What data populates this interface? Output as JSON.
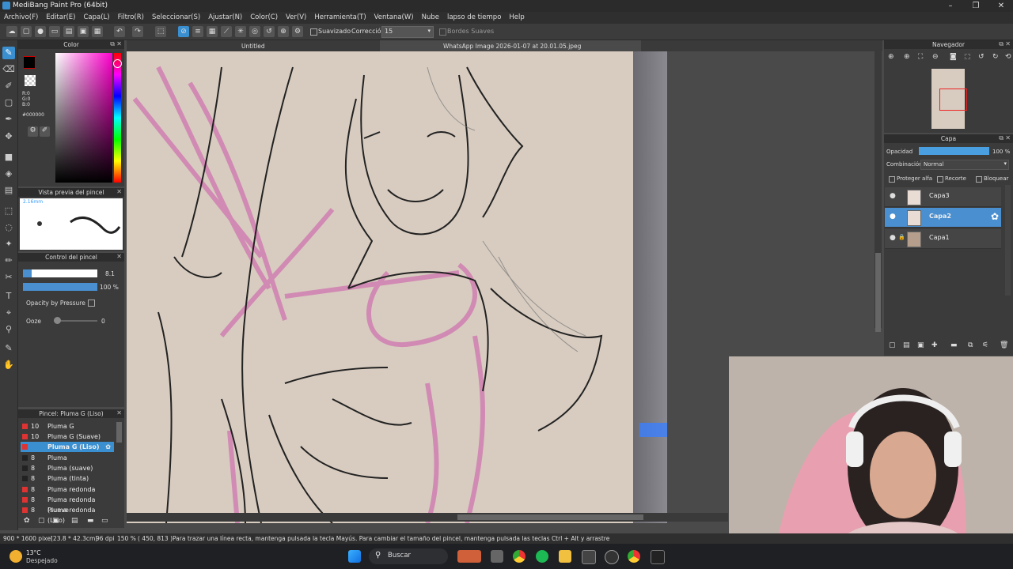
{
  "window": {
    "title": "MediBang Paint Pro (64bit)"
  },
  "menu": [
    "Archivo(F)",
    "Editar(E)",
    "Capa(L)",
    "Filtro(R)",
    "Seleccionar(S)",
    "Ajustar(N)",
    "Color(C)",
    "Ver(V)",
    "Herramienta(T)",
    "Ventana(W)",
    "Nube",
    "lapso de tiempo",
    "Help"
  ],
  "toolbar": {
    "smoothing_label": "Suavizado",
    "correction_label": "Corrección",
    "correction_value": "15",
    "soft_edges_label": "Bordes Suaves"
  },
  "tabs": {
    "untitled": "Untitled",
    "document": "WhatsApp Image 2026-01-07 at 20.01.05.jpeg"
  },
  "color_panel": {
    "title": "Color",
    "r": "R:0",
    "g": "G:0",
    "b": "B:0",
    "hex": "#000000",
    "fg": "#000000",
    "accent": "#cc0000"
  },
  "brush_preview": {
    "title": "Vista previa del pincel",
    "size": "2.16mm"
  },
  "brush_control": {
    "title": "Control del pincel",
    "size_value": "8.1",
    "opacity_value": "100 %",
    "opacity_by_pressure": "Opacity by Pressure",
    "ooze_label": "Ooze",
    "ooze_value": "0"
  },
  "brush_list": {
    "title": "Pincel: Pluma G (Liso)",
    "items": [
      {
        "size": "10",
        "name": "Pluma G",
        "color": "#d33"
      },
      {
        "size": "10",
        "name": "Pluma G (Suave)",
        "color": "#d33"
      },
      {
        "size": "",
        "name": "Pluma G (Liso)",
        "color": "#d33"
      },
      {
        "size": "8",
        "name": "Pluma",
        "color": "#222"
      },
      {
        "size": "8",
        "name": "Pluma (suave)",
        "color": "#222"
      },
      {
        "size": "8",
        "name": "Pluma (tinta)",
        "color": "#222"
      },
      {
        "size": "8",
        "name": "Pluma redonda",
        "color": "#d33"
      },
      {
        "size": "8",
        "name": "Pluma redonda (suave",
        "color": "#d33"
      },
      {
        "size": "8",
        "name": "Pluma redonda (Liso)",
        "color": "#d33"
      }
    ]
  },
  "navigator": {
    "title": "Navegador"
  },
  "layers": {
    "title": "Capa",
    "opacity_label": "Opacidad",
    "opacity_value": "100 %",
    "blend_label": "Combinación",
    "blend_value": "Normal",
    "protect_alpha": "Proteger alfa",
    "clip": "Recorte",
    "lock": "Bloquear",
    "items": [
      "Capa3",
      "Capa2",
      "Capa1"
    ]
  },
  "status": {
    "size": "900 * 1600 pixel",
    "physical": "(23.8 * 42.3cm)",
    "dpi": "96 dpi",
    "zoom": "150 %",
    "coords": "( 450, 813 )",
    "hint": "Para trazar una línea recta, mantenga pulsada la tecla Mayús. Para cambiar el tamaño del pincel, mantenga pulsada las teclas Ctrl + Alt y arrastre"
  },
  "taskbar": {
    "temp": "13°C",
    "weather": "Despejado",
    "search": "Buscar"
  }
}
